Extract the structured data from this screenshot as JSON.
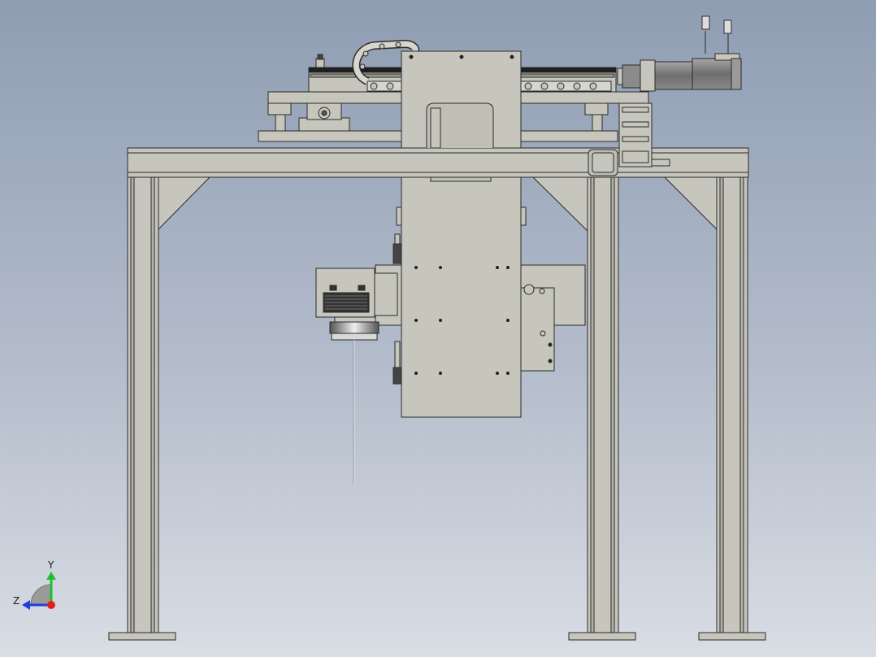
{
  "viewport": {
    "background_top": "#8f9db3",
    "background_bottom": "#d9dde4"
  },
  "model": {
    "part_fill": "#c7c6bd",
    "part_fill_dark": "#a9a89e",
    "edge_color": "#2a2a2a",
    "motor_color": "#8d8d8d"
  },
  "triad": {
    "y_label": "Y",
    "z_label": "Z",
    "y_color": "#1fbf2f",
    "z_color": "#1f3fd6",
    "x_color": "#e0201c"
  }
}
